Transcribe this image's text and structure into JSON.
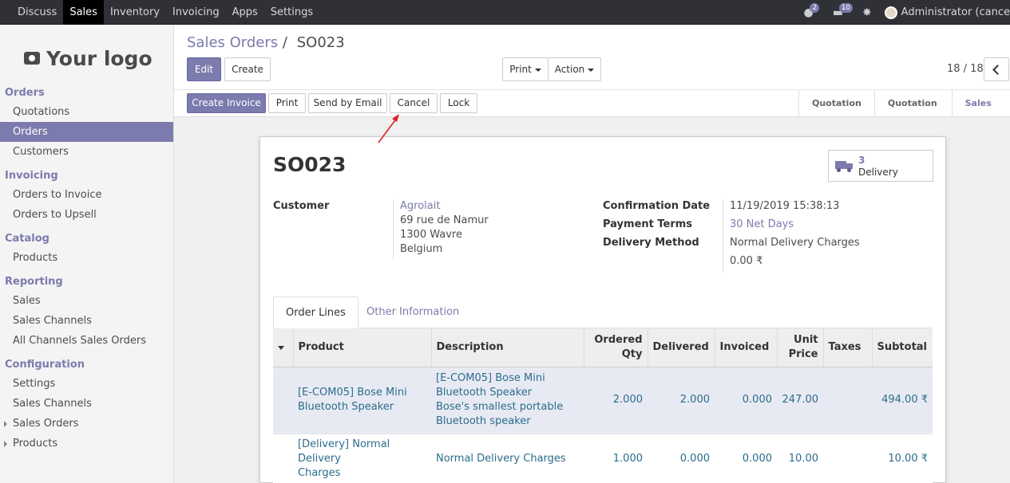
{
  "topbar": {
    "menu": [
      "Discuss",
      "Sales",
      "Inventory",
      "Invoicing",
      "Apps",
      "Settings"
    ],
    "active": "Sales",
    "messages_count": "2",
    "activity_count": "10",
    "user": "Administrator (cance"
  },
  "sidebar": {
    "logo_text": "Your logo",
    "orders_section": "Orders",
    "quotations": "Quotations",
    "orders": "Orders",
    "customers": "Customers",
    "invoicing_section": "Invoicing",
    "orders_to_invoice": "Orders to Invoice",
    "orders_to_upsell": "Orders to Upsell",
    "catalog_section": "Catalog",
    "products": "Products",
    "reporting_section": "Reporting",
    "rep_sales": "Sales",
    "rep_sales_channels": "Sales Channels",
    "rep_all_channels": "All Channels Sales Orders",
    "configuration_section": "Configuration",
    "conf_settings": "Settings",
    "conf_sales_channels": "Sales Channels",
    "conf_sales_orders": "Sales Orders",
    "conf_products": "Products"
  },
  "control_panel": {
    "breadcrumb_parent": "Sales Orders",
    "breadcrumb_sep": "/",
    "breadcrumb_current": "SO023",
    "edit": "Edit",
    "create": "Create",
    "print": "Print",
    "action": "Action",
    "pager": "18 / 18"
  },
  "header_buttons": {
    "create_invoice": "Create Invoice",
    "print": "Print",
    "send_by_email": "Send by Email",
    "cancel": "Cancel",
    "lock": "Lock"
  },
  "statusbar": [
    "Quotation",
    "Quotation Sent",
    "Sales Ord"
  ],
  "form": {
    "title": "SO023",
    "delivery_count": "3",
    "delivery_label": "Delivery",
    "customer_label": "Customer",
    "customer_name": "Agrolait",
    "address_1": "69 rue de Namur",
    "address_2": "1300 Wavre",
    "address_3": "Belgium",
    "confirmation_date_label": "Confirmation Date",
    "confirmation_date": "11/19/2019 15:38:13",
    "payment_terms_label": "Payment Terms",
    "payment_terms": "30 Net Days",
    "delivery_method_label": "Delivery Method",
    "delivery_method": "Normal Delivery Charges",
    "delivery_price": "0.00 ₹",
    "tab_order_lines": "Order Lines",
    "tab_other_info": "Other Information"
  },
  "order_lines": {
    "headers": {
      "product": "Product",
      "description": "Description",
      "ordered_1": "Ordered",
      "ordered_2": "Qty",
      "delivered": "Delivered",
      "invoiced": "Invoiced",
      "unit_1": "Unit",
      "unit_2": "Price",
      "taxes": "Taxes",
      "subtotal": "Subtotal"
    },
    "rows": [
      {
        "product_1": "[E-COM05] Bose Mini",
        "product_2": "Bluetooth Speaker",
        "desc_1": "[E-COM05] Bose Mini",
        "desc_2": "Bluetooth Speaker",
        "desc_3": "Bose's smallest portable",
        "desc_4": "Bluetooth speaker",
        "qty": "2.000",
        "delivered": "2.000",
        "invoiced": "0.000",
        "price": "247.00",
        "taxes": "",
        "subtotal": "494.00 ₹"
      },
      {
        "product_1": "[Delivery] Normal Delivery",
        "product_2": "Charges",
        "desc_1": "Normal Delivery Charges",
        "qty": "1.000",
        "delivered": "0.000",
        "invoiced": "0.000",
        "price": "10.00",
        "taxes": "",
        "subtotal": "10.00 ₹"
      }
    ]
  },
  "colors": {
    "brand": "#7c7bad",
    "topbar": "#2f3136",
    "link": "#2a6c8c",
    "annotation_arrow": "#e0201e"
  }
}
